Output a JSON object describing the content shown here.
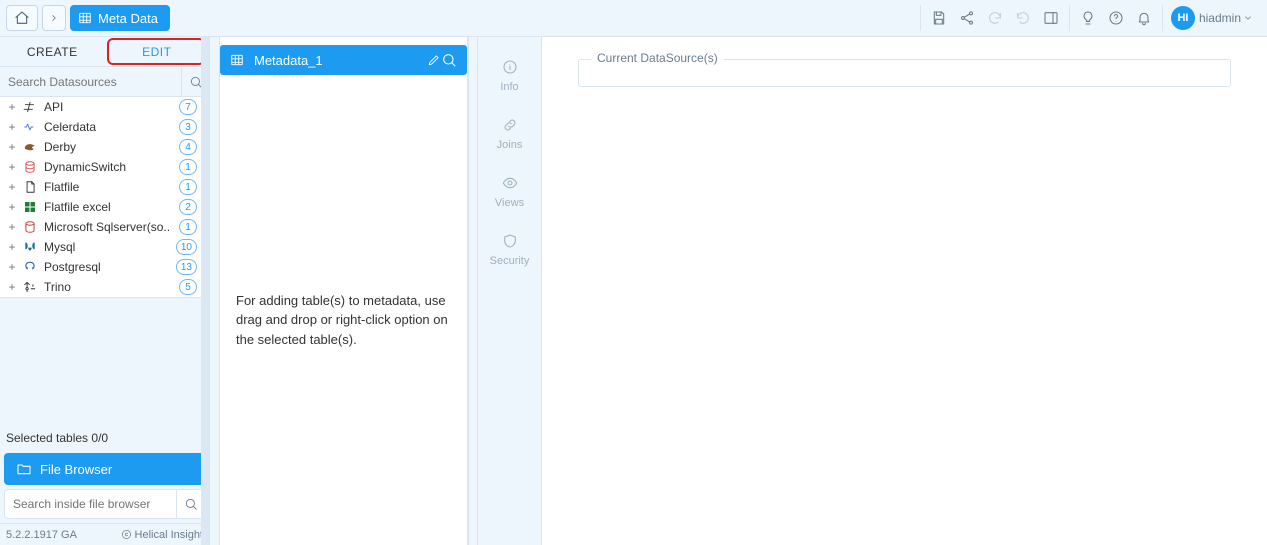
{
  "header": {
    "breadcrumb_title": "Meta Data",
    "user_initials": "HI",
    "username": "hiadmin"
  },
  "left": {
    "tab_create": "CREATE",
    "tab_edit": "EDIT",
    "search_placeholder": "Search Datasources",
    "datasources": [
      {
        "name": "API",
        "count": 7
      },
      {
        "name": "Celerdata",
        "count": 3
      },
      {
        "name": "Derby",
        "count": 4
      },
      {
        "name": "DynamicSwitch",
        "count": 1
      },
      {
        "name": "Flatfile",
        "count": 1
      },
      {
        "name": "Flatfile excel",
        "count": 2
      },
      {
        "name": "Microsoft Sqlserver(so..",
        "count": 1
      },
      {
        "name": "Mysql",
        "count": 10
      },
      {
        "name": "Postgresql",
        "count": 13
      },
      {
        "name": "Trino",
        "count": 5
      }
    ],
    "selected_tables": "Selected tables 0/0",
    "file_browser": "File Browser",
    "fb_search_placeholder": "Search inside file browser",
    "version": "5.2.2.1917 GA",
    "copyright": "Helical Insight"
  },
  "meta": {
    "title": "Metadata_1",
    "instruction": "For adding table(s) to metadata, use drag and drop or right-click option on the selected table(s)."
  },
  "rail": {
    "info": "Info",
    "joins": "Joins",
    "views": "Views",
    "security": "Security"
  },
  "right": {
    "current_ds": "Current DataSource(s)"
  }
}
